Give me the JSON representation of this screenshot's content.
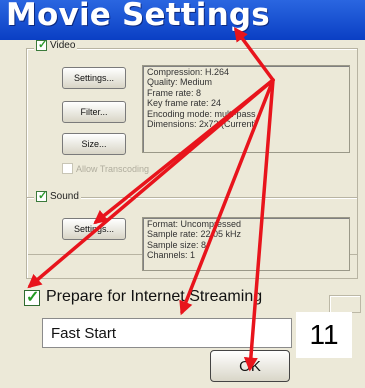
{
  "window": {
    "title": "Movie Settings"
  },
  "video": {
    "legend": "Video",
    "checked": true,
    "buttons": {
      "settings": "Settings...",
      "filter": "Filter...",
      "size": "Size..."
    },
    "info": [
      "Compression: H.264",
      "Quality: Medium",
      "Frame rate: 8",
      "Key frame rate: 24",
      "Encoding mode: multi-pass",
      "Dimensions: 2x72 (Current)"
    ],
    "allow_transcoding": {
      "label": "Allow Transcoding",
      "checked": false,
      "enabled": false
    }
  },
  "sound": {
    "legend": "Sound",
    "checked": true,
    "buttons": {
      "settings": "Settings..."
    },
    "info": [
      "Format: Uncompressed",
      "Sample rate: 22.05 kHz",
      "Sample size: 8",
      "Channels: 1"
    ]
  },
  "streaming": {
    "label": "Prepare for Internet Streaming",
    "checked": true,
    "selected_option": "Fast Start"
  },
  "ok_button": "OK",
  "step_badge": "11",
  "colors": {
    "arrow": "#e8141c",
    "title_bar": "#0a3fc4",
    "dialog_bg": "#ece9d8",
    "checkmark": "#2c9a2c"
  }
}
